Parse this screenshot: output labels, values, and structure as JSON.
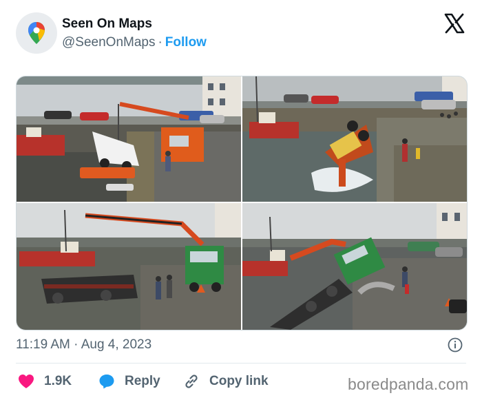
{
  "author": {
    "name": "Seen On Maps",
    "handle": "@SeenOnMaps",
    "separator": "·",
    "follow_label": "Follow",
    "avatar_icon": "map-pin-icon"
  },
  "platform_icon": "x-logo-icon",
  "media": {
    "count": 4
  },
  "meta": {
    "time": "11:19 AM",
    "separator": "·",
    "date": "Aug 4, 2023",
    "timestamp": "11:19 AM · Aug 4, 2023",
    "info_icon": "info-icon"
  },
  "actions": {
    "likes_count": "1.9K",
    "reply_label": "Reply",
    "copy_link_label": "Copy link"
  },
  "watermark": "boredpanda.com",
  "colors": {
    "accent": "#1d9bf0",
    "like": "#f91880",
    "muted": "#536471",
    "text": "#0f1419"
  }
}
